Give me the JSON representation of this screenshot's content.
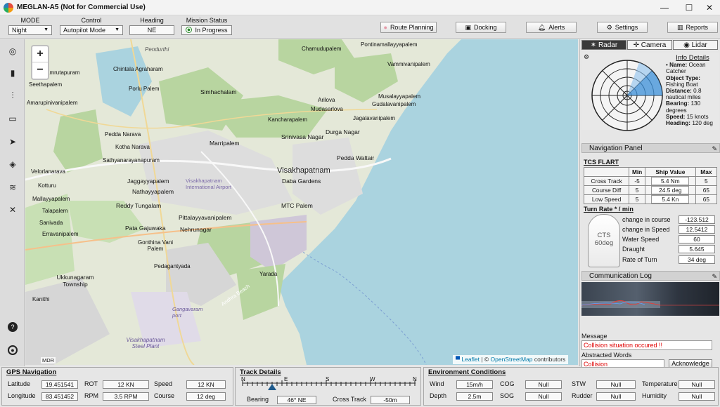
{
  "app": {
    "title": "MEGLAN-A5 (Not for Commercial Use)"
  },
  "window_controls": {
    "minimize": "—",
    "maximize": "☐",
    "close": "✕"
  },
  "toolbar": {
    "mode": {
      "label": "MODE",
      "value": "Night"
    },
    "control": {
      "label": "Control",
      "value": "Autopilot Mode"
    },
    "heading": {
      "label": "Heading",
      "value": "NE"
    },
    "mission": {
      "label": "Mission Status",
      "value": "In Progress"
    },
    "buttons": {
      "route_planning": "Route Planning",
      "docking": "Docking",
      "alerts": "Alerts",
      "settings": "Settings",
      "reports": "Reports"
    }
  },
  "sidebar": {
    "items": [
      "target-icon",
      "bar-chart-icon",
      "sliders-icon",
      "battery-icon",
      "navigation-arrow-icon",
      "layers-icon",
      "wifi-icon",
      "mute-icon"
    ],
    "bottom": [
      "help-icon",
      "user-icon"
    ]
  },
  "map": {
    "zoom_in": "+",
    "zoom_out": "−",
    "labels": {
      "pendurthi": "Pendurthi",
      "chamudupalem": "Chamudupalem",
      "pontinamallayyapalem": "Pontinamallayyapalem",
      "vammivanipalem": "Vammivanipalem",
      "chintala": "Chintala Agraharam",
      "porlu": "Porlu Palem",
      "amrutapuram": "amrutapuram",
      "simhachalam": "Simhachalam",
      "arilova": "Arilova",
      "mudasarlova": "Mudasarlova",
      "musalayya": "Musalayyapalem",
      "gudalavani": "Gudalavanipalem",
      "jagala": "Jagalavanipalem",
      "amarupini": "Amarupinivanipalem",
      "durga": "Durga Nagar",
      "pedda_narava": "Pedda Narava",
      "kotha_narava": "Kotha Narava",
      "marripalem": "Marripalem",
      "srinivasa": "Srinivasa Nagar",
      "pedda_waltair": "Pedda Waltair",
      "sathyanarayana": "Sathyanarayanapuram",
      "velorlanarava": "Velorlanarava",
      "visakhapatnam": "Visakhapatnam",
      "daba": "Daba Gardens",
      "jaggayya": "Jaggayyapalem",
      "kotturu": "Kotturu",
      "nathayya": "Nathayyapalem",
      "airport": "Visakhapatnam International Airport",
      "mallayya": "Mallayyapalem",
      "reddy": "Reddy Tungalam",
      "mtc": "MTC Palem",
      "talapalem": "Talapalem",
      "pittala": "Pittalayyavanipalem",
      "sanivada": "Sanivada",
      "pata": "Pata Gajuwaka",
      "nehrunagar": "Nehrunagar",
      "erravani": "Erravanipalem",
      "gonthina": "Gonthina Vani Palem",
      "pedagant": "Pedagantyada",
      "ukkunagaram": "Ukkunagaram Township",
      "yarada": "Yarada",
      "gangavaram": "Gangavaram port",
      "kanithi": "Kanithi",
      "andhra": "Andhra Beach",
      "steel": "Visakhapatnam Steel Plant",
      "seethapalem": "Seethapalem",
      "kancha": "Kancharapalem",
      "mdr": "MDR"
    },
    "attribution": {
      "leaflet": "Leaflet",
      "sep": " | © ",
      "osm": "OpenStreetMap",
      "contrib": " contributors"
    }
  },
  "right_panel": {
    "tabs": {
      "radar": "Radar",
      "camera": "Camera",
      "lidar": "Lidar"
    },
    "info": {
      "title": "Info Details",
      "name_label": "Name:",
      "name": "Ocean Catcher",
      "type_label": "Object Type:",
      "type": "Fishing Boat",
      "distance_label": "Distance:",
      "distance": "0.8 nautical miles",
      "bearing_label": "Bearing:",
      "bearing": "130 degrees",
      "speed_label": "Speed:",
      "speed": "15 knots",
      "heading_label": "Heading:",
      "heading": "120 deg"
    },
    "navigation_panel": {
      "title": "Navigation Panel",
      "tcs_title": "TCS FLART",
      "headers": [
        "",
        "Min",
        "Ship Value",
        "Max"
      ],
      "rows": [
        {
          "name": "Cross Track",
          "min": "-5",
          "value": "5.4 Nm",
          "max": "5"
        },
        {
          "name": "Course Diff",
          "min": "5",
          "value": "24.5 deg",
          "max": "65"
        },
        {
          "name": "Low Speed",
          "min": "5",
          "value": "5.4 Kn",
          "max": "65"
        }
      ],
      "turn_rate_title": "Turn Rate * / min",
      "cts_label": "CTS",
      "cts_value": "60deg",
      "turn_rows": [
        {
          "label": "change in course",
          "value": "-123.512"
        },
        {
          "label": "change in Speed",
          "value": "12.5412"
        },
        {
          "label": "Water Speed",
          "value": "60"
        },
        {
          "label": "Draught",
          "value": "5.645"
        },
        {
          "label": "Rate of Turn",
          "value": "34 deg"
        }
      ]
    },
    "communication_log": {
      "title": "Communication Log",
      "message_label": "Message",
      "message": "Collision situation occured !!",
      "abstracted_label": "Abstracted Words",
      "abstracted": "Collision",
      "ack_button": "Acknowledge"
    }
  },
  "gps": {
    "title": "GPS Navigation",
    "latitude_label": "Latitude",
    "latitude": "19.451541",
    "longitude_label": "Longitude",
    "longitude": "83.451452",
    "rot_label": "ROT",
    "rot": "12 KN",
    "rpm_label": "RPM",
    "rpm": "3.5 RPM",
    "speed_label": "Speed",
    "speed": "12 KN",
    "course_label": "Course",
    "course": "12 deg"
  },
  "track": {
    "title": "Track Details",
    "compass": [
      "N",
      "E",
      "S",
      "W",
      "N"
    ],
    "bearing_label": "Bearing",
    "bearing": "46° NE",
    "cross_track_label": "Cross Track",
    "cross_track": "-50m"
  },
  "environment": {
    "title": "Environment Conditions",
    "wind_label": "Wind",
    "wind": "15m/h",
    "depth_label": "Depth",
    "depth": "2.5m",
    "cog_label": "COG",
    "cog": "Null",
    "sog_label": "SOG",
    "sog": "Null",
    "stw_label": "STW",
    "stw": "Null",
    "rudder_label": "Rudder",
    "rudder": "Null",
    "temperature_label": "Temperature",
    "temperature": "Null",
    "humidity_label": "Humidity",
    "humidity": "Null"
  }
}
